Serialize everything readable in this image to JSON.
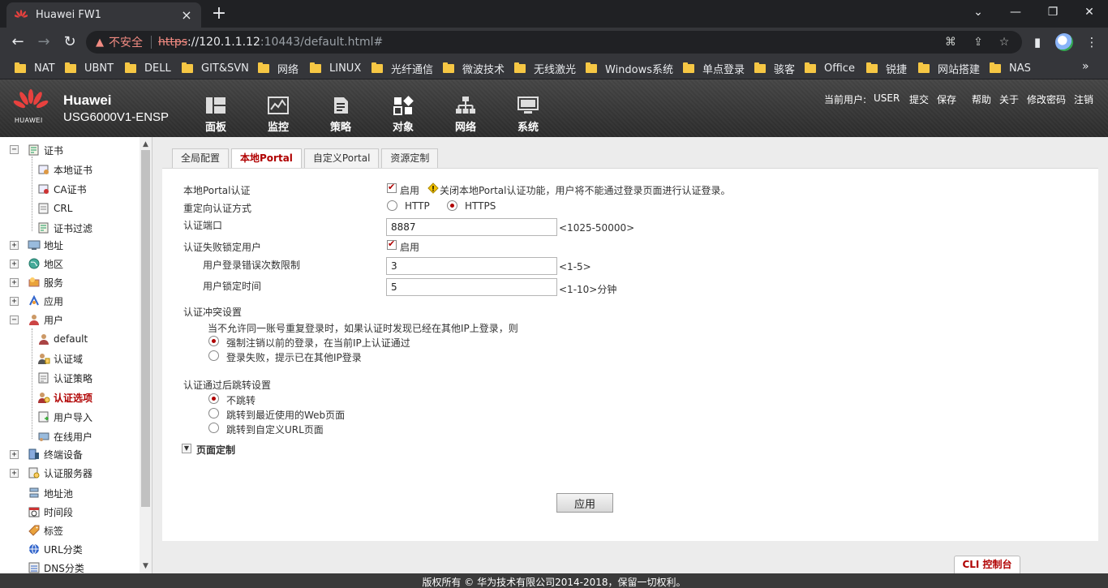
{
  "browser": {
    "tab_title": "Huawei FW1",
    "insecure_label": "不安全",
    "url_scheme": "https",
    "url_host": "://120.1.1.12",
    "url_rest": ":10443/default.html#",
    "bookmarks": [
      "NAT",
      "UBNT",
      "DELL",
      "GIT&SVN",
      "网络",
      "LINUX",
      "光纤通信",
      "微波技术",
      "无线激光",
      "Windows系统",
      "单点登录",
      "骇客",
      "Office",
      "锐捷",
      "网站搭建",
      "NAS"
    ]
  },
  "header": {
    "brand": "Huawei",
    "model": "USG6000V1-ENSP",
    "logo_text": "HUAWEI",
    "nav": [
      {
        "label": "面板",
        "icon": "dashboard-icon"
      },
      {
        "label": "监控",
        "icon": "monitor-icon"
      },
      {
        "label": "策略",
        "icon": "policy-icon"
      },
      {
        "label": "对象",
        "icon": "object-icon"
      },
      {
        "label": "网络",
        "icon": "network-icon"
      },
      {
        "label": "系统",
        "icon": "system-icon"
      }
    ],
    "current_user_label": "当前用户:",
    "current_user": "USER",
    "actions": [
      "提交",
      "保存",
      "帮助",
      "关于",
      "修改密码",
      "注销"
    ]
  },
  "sidebar": {
    "items": [
      {
        "label": "证书",
        "icon": "certificate-icon"
      },
      {
        "label": "本地证书",
        "icon": "local-cert-icon"
      },
      {
        "label": "CA证书",
        "icon": "ca-cert-icon"
      },
      {
        "label": "CRL",
        "icon": "crl-icon"
      },
      {
        "label": "证书过滤",
        "icon": "cert-filter-icon"
      },
      {
        "label": "地址",
        "icon": "address-icon"
      },
      {
        "label": "地区",
        "icon": "region-icon"
      },
      {
        "label": "服务",
        "icon": "service-icon"
      },
      {
        "label": "应用",
        "icon": "application-icon"
      },
      {
        "label": "用户",
        "icon": "user-icon"
      },
      {
        "label": "default",
        "icon": "user-default-icon"
      },
      {
        "label": "认证域",
        "icon": "auth-domain-icon"
      },
      {
        "label": "认证策略",
        "icon": "auth-policy-icon"
      },
      {
        "label": "认证选项",
        "icon": "auth-option-icon"
      },
      {
        "label": "用户导入",
        "icon": "user-import-icon"
      },
      {
        "label": "在线用户",
        "icon": "online-user-icon"
      },
      {
        "label": "终端设备",
        "icon": "terminal-device-icon"
      },
      {
        "label": "认证服务器",
        "icon": "auth-server-icon"
      },
      {
        "label": "地址池",
        "icon": "address-pool-icon"
      },
      {
        "label": "时间段",
        "icon": "time-range-icon"
      },
      {
        "label": "标签",
        "icon": "tag-icon"
      },
      {
        "label": "URL分类",
        "icon": "url-category-icon"
      },
      {
        "label": "DNS分类",
        "icon": "dns-category-icon"
      }
    ]
  },
  "tabs": [
    "全局配置",
    "本地Portal",
    "自定义Portal",
    "资源定制"
  ],
  "form": {
    "local_portal_label": "本地Portal认证",
    "enable_label": "启用",
    "local_portal_warning": "关闭本地Portal认证功能，用户将不能通过登录页面进行认证登录。",
    "redirect_label": "重定向认证方式",
    "http_label": "HTTP",
    "https_label": "HTTPS",
    "port_label": "认证端口",
    "port_value": "8887",
    "port_hint": "<1025-50000>",
    "lock_label": "认证失败锁定用户",
    "lock_enable_label": "启用",
    "fail_count_label": "用户登录错误次数限制",
    "fail_count_value": "3",
    "fail_count_hint": "<1-5>",
    "lock_time_label": "用户锁定时间",
    "lock_time_value": "5",
    "lock_time_hint": "<1-10>分钟",
    "conflict_label": "认证冲突设置",
    "conflict_desc": "当不允许同一账号重复登录时，如果认证时发现已经在其他IP上登录，则",
    "conflict_opt1": "强制注销以前的登录，在当前IP上认证通过",
    "conflict_opt2": "登录失败，提示已在其他IP登录",
    "redirect_after_label": "认证通过后跳转设置",
    "redirect_opt1": "不跳转",
    "redirect_opt2": "跳转到最近使用的Web页面",
    "redirect_opt3": "跳转到自定义URL页面",
    "page_custom_label": "页面定制",
    "apply_label": "应用"
  },
  "cli_label": "CLI 控制台",
  "footer": "版权所有 © 华为技术有限公司2014-2018，保留一切权利。"
}
